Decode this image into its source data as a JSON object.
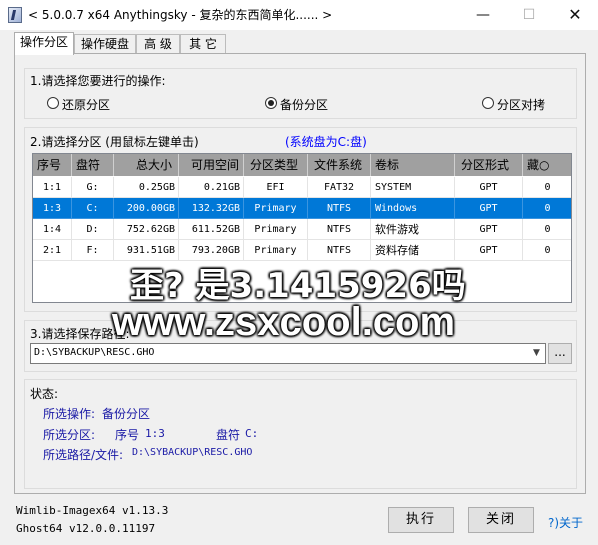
{
  "window": {
    "title": "< 5.0.0.7 x64 Anythingsky - 复杂的东西简单化...... >",
    "minimize": "—",
    "maximize": "☐",
    "close": "✕"
  },
  "tabs": [
    {
      "label": "操作分区"
    },
    {
      "label": "操作硬盘"
    },
    {
      "label": "高 级"
    },
    {
      "label": "其 它"
    }
  ],
  "operation": {
    "heading": "1.请选择您要进行的操作:",
    "options": [
      {
        "label": "还原分区",
        "checked": false
      },
      {
        "label": "备份分区",
        "checked": true
      },
      {
        "label": "分区对拷",
        "checked": false
      }
    ]
  },
  "partition": {
    "heading": "2.请选择分区 (用鼠标左键单击)",
    "system_note": "(系统盘为C:盘)",
    "columns": [
      "序号",
      "盘符",
      "总大小",
      "可用空间",
      "分区类型",
      "文件系统",
      "卷标",
      "分区形式",
      "藏○"
    ],
    "rows": [
      {
        "index": "1:1",
        "drive": "G:",
        "total": "0.25GB",
        "free": "0.21GB",
        "type": "EFI",
        "fs": "FAT32",
        "label": "SYSTEM",
        "style": "GPT",
        "hidden": "0",
        "selected": false
      },
      {
        "index": "1:3",
        "drive": "C:",
        "total": "200.00GB",
        "free": "132.32GB",
        "type": "Primary",
        "fs": "NTFS",
        "label": "Windows",
        "style": "GPT",
        "hidden": "0",
        "selected": true
      },
      {
        "index": "1:4",
        "drive": "D:",
        "total": "752.62GB",
        "free": "611.52GB",
        "type": "Primary",
        "fs": "NTFS",
        "label": "软件游戏",
        "style": "GPT",
        "hidden": "0",
        "selected": false
      },
      {
        "index": "2:1",
        "drive": "F:",
        "total": "931.51GB",
        "free": "793.20GB",
        "type": "Primary",
        "fs": "NTFS",
        "label": "资料存储",
        "style": "GPT",
        "hidden": "0",
        "selected": false
      }
    ]
  },
  "save_path": {
    "heading": "3.请选择保存路径:",
    "value": "D:\\SYBACKUP\\RESC.GHO",
    "browse": "..."
  },
  "status": {
    "heading": "状态:",
    "operation_label": "所选操作:",
    "operation_value": "备份分区",
    "partition_label": "所选分区:",
    "partition_index_label": "序号",
    "partition_index_value": "1:3",
    "partition_drive_label": "盘符",
    "partition_drive_value": "C:",
    "path_label": "所选路径/文件:",
    "path_value": "D:\\SYBACKUP\\RESC.GHO"
  },
  "footer": {
    "wimlib": "Wimlib-Imagex64 v1.13.3",
    "ghost": "Ghost64 v12.0.0.11197",
    "execute": "执行",
    "close": "关闭",
    "about": "?)关于"
  },
  "watermark": {
    "line1": "歪? 是3.1415926吗",
    "line2": "www.zsxcool.com"
  }
}
